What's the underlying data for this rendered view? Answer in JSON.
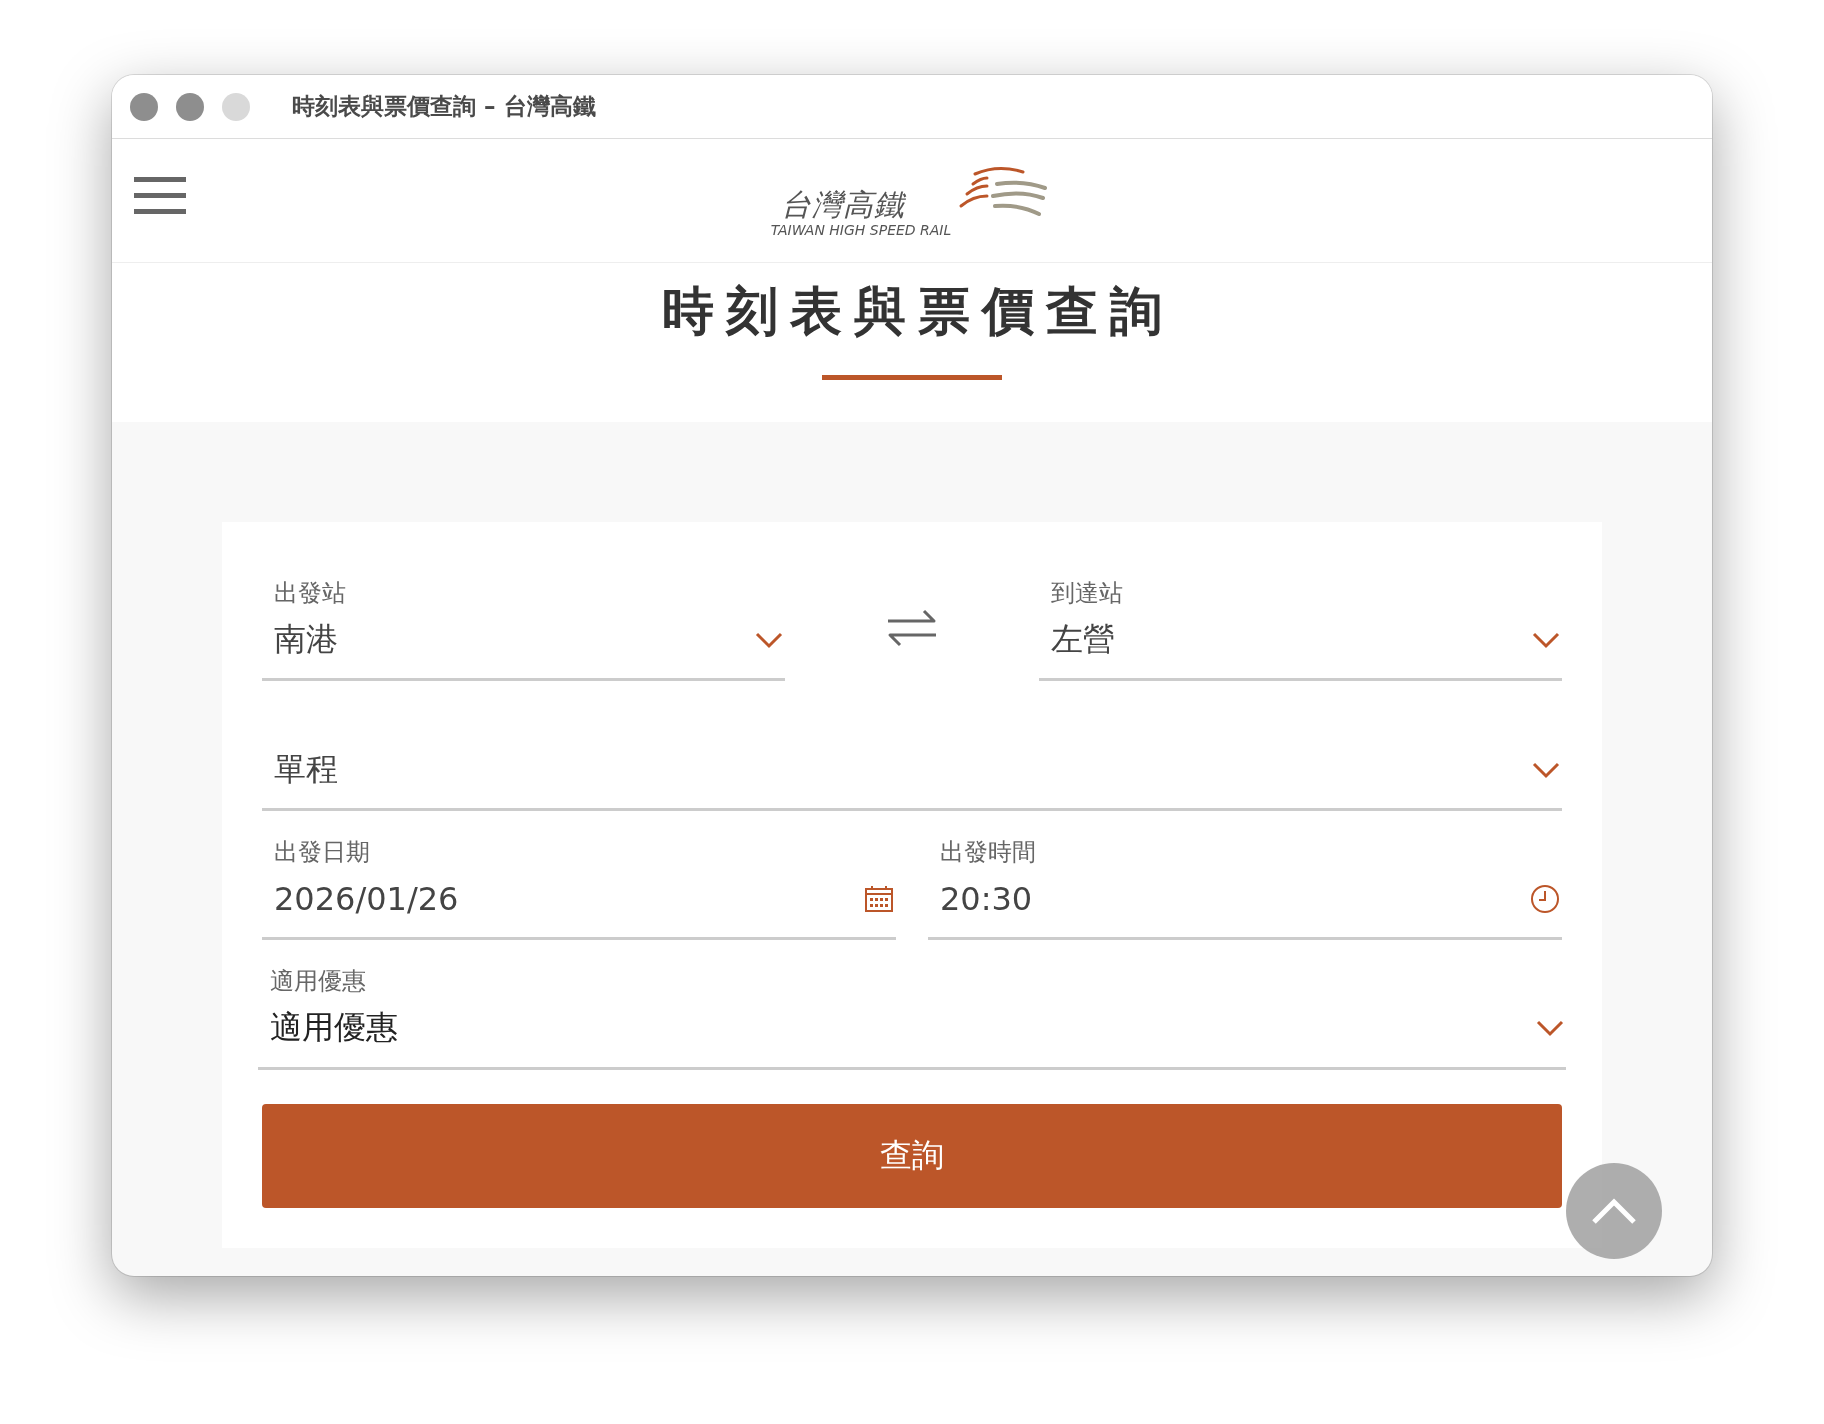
{
  "window": {
    "title": "時刻表與票價查詢 – 台灣高鐵"
  },
  "header": {
    "logo_text": "台灣高鐵",
    "logo_subtitle": "TAIWAN HIGH SPEED RAIL"
  },
  "page_title": "時刻表與票價查詢",
  "form": {
    "departure": {
      "label": "出發站",
      "value": "南港"
    },
    "arrival": {
      "label": "到達站",
      "value": "左營"
    },
    "trip_type": {
      "value": "單程"
    },
    "date": {
      "label": "出發日期",
      "value": "2026/01/26"
    },
    "time": {
      "label": "出發時間",
      "value": "20:30"
    },
    "discount": {
      "label": "適用優惠",
      "value": "適用優惠"
    },
    "submit": "查詢"
  }
}
